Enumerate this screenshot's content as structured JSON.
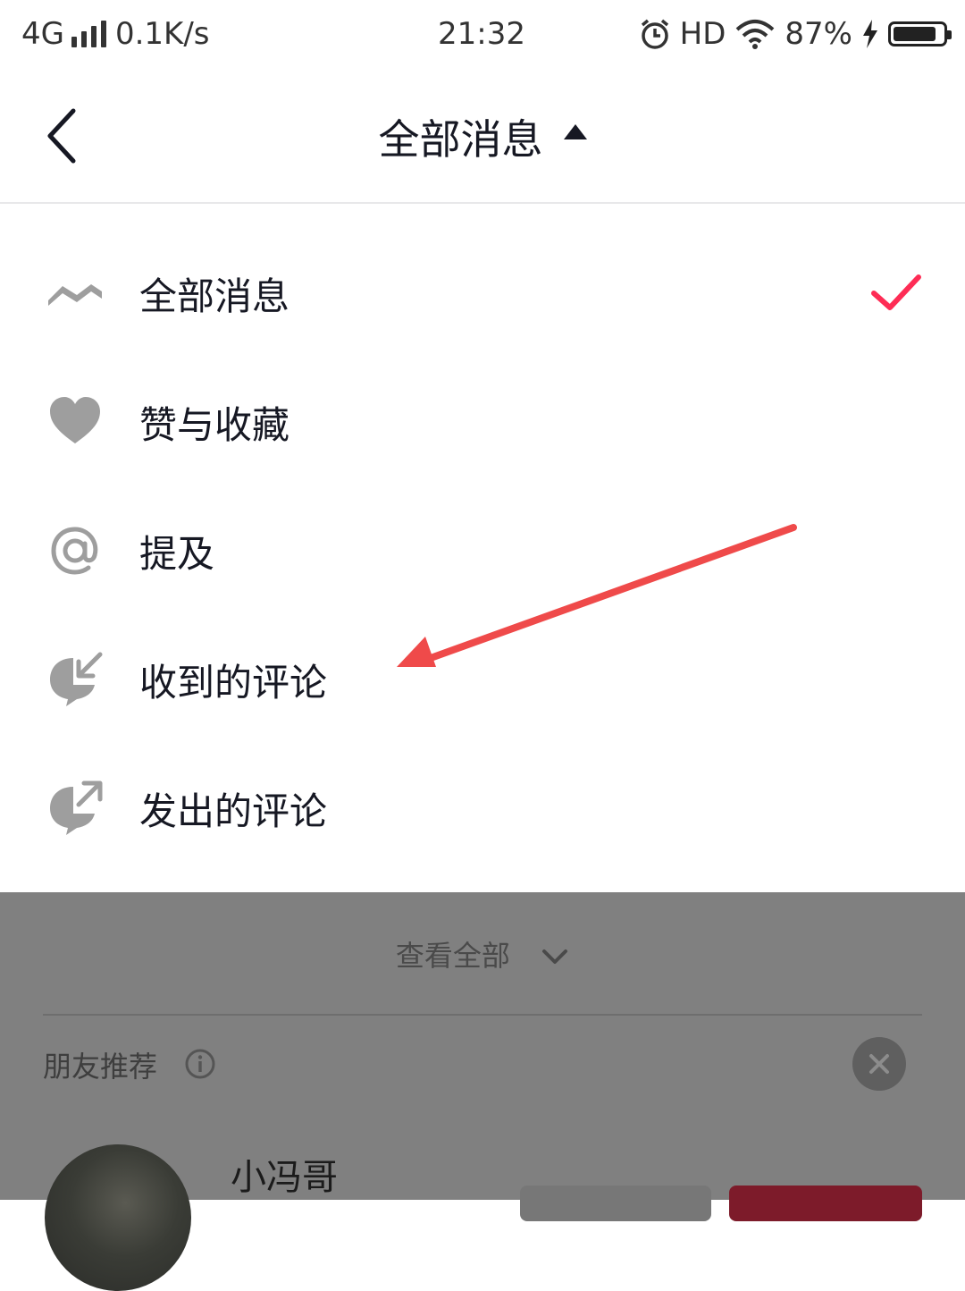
{
  "status_bar": {
    "network": "4G",
    "speed": "0.1K/s",
    "time": "21:32",
    "hd": "HD",
    "battery": "87%",
    "battery_level": 0.87
  },
  "header": {
    "title": "全部消息"
  },
  "menu": {
    "items": [
      {
        "label": "全部消息",
        "icon": "wave-icon",
        "selected": true
      },
      {
        "label": "赞与收藏",
        "icon": "heart-icon",
        "selected": false
      },
      {
        "label": "提及",
        "icon": "at-icon",
        "selected": false
      },
      {
        "label": "收到的评论",
        "icon": "comment-received-icon",
        "selected": false
      },
      {
        "label": "发出的评论",
        "icon": "comment-sent-icon",
        "selected": false
      }
    ]
  },
  "background": {
    "see_all": "查看全部",
    "friends_title": "朋友推荐",
    "friend_name": "小冯哥"
  },
  "colors": {
    "accent": "#FE2C55",
    "annotation": "#EF4A4A",
    "icon_gray": "#9E9E9E"
  }
}
